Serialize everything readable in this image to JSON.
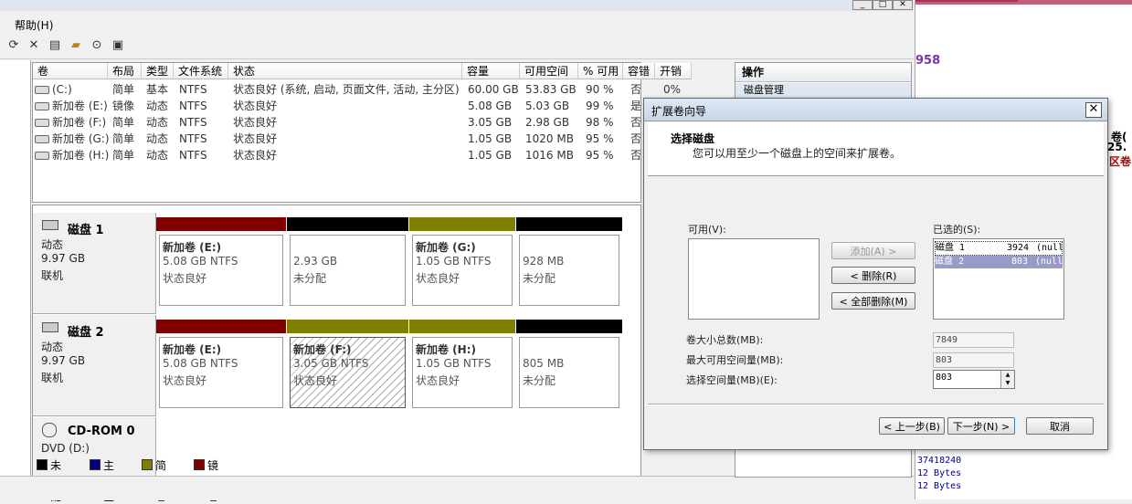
{
  "menu": {
    "help": "帮助(H)"
  },
  "window_buttons": {
    "minimize": "_",
    "maximize": "□",
    "close": "✕"
  },
  "toolbar_icons": [
    "refresh-icon",
    "delete-icon",
    "properties-icon",
    "open-folder-icon",
    "help-icon",
    "console-icon"
  ],
  "volume_table": {
    "headers": [
      "卷",
      "布局",
      "类型",
      "文件系统",
      "状态",
      "容量",
      "可用空间",
      "% 可用",
      "容错",
      "开销"
    ],
    "rows": [
      [
        "(C:)",
        "简单",
        "基本",
        "NTFS",
        "状态良好 (系统, 启动, 页面文件, 活动, 主分区)",
        "60.00 GB",
        "53.83 GB",
        "90 %",
        "否",
        "0%"
      ],
      [
        "新加卷 (E:)",
        "镜像",
        "动态",
        "NTFS",
        "状态良好",
        "5.08 GB",
        "5.03 GB",
        "99 %",
        "是",
        ""
      ],
      [
        "新加卷 (F:)",
        "简单",
        "动态",
        "NTFS",
        "状态良好",
        "3.05 GB",
        "2.98 GB",
        "98 %",
        "否",
        ""
      ],
      [
        "新加卷 (G:)",
        "简单",
        "动态",
        "NTFS",
        "状态良好",
        "1.05 GB",
        "1020 MB",
        "95 %",
        "否",
        ""
      ],
      [
        "新加卷 (H:)",
        "简单",
        "动态",
        "NTFS",
        "状态良好",
        "1.05 GB",
        "1016 MB",
        "95 %",
        "否",
        ""
      ]
    ]
  },
  "disks": [
    {
      "name": "磁盘 1",
      "type": "动态",
      "size": "9.97 GB",
      "status": "联机",
      "partitions": [
        {
          "name": "新加卷  (E:)",
          "size": "5.08 GB NTFS",
          "status": "状态良好",
          "color": "#800000"
        },
        {
          "name": "",
          "size": "2.93 GB",
          "status": "未分配",
          "color": "#000000"
        },
        {
          "name": "新加卷  (G:)",
          "size": "1.05 GB NTFS",
          "status": "状态良好",
          "color": "#808000"
        },
        {
          "name": "",
          "size": "928 MB",
          "status": "未分配",
          "color": "#000000"
        }
      ]
    },
    {
      "name": "磁盘 2",
      "type": "动态",
      "size": "9.97 GB",
      "status": "联机",
      "partitions": [
        {
          "name": "新加卷  (E:)",
          "size": "5.08 GB NTFS",
          "status": "状态良好",
          "color": "#800000"
        },
        {
          "name": "新加卷  (F:)",
          "size": "3.05 GB NTFS",
          "status": "状态良好",
          "color": "#808000"
        },
        {
          "name": "新加卷  (H:)",
          "size": "1.05 GB NTFS",
          "status": "状态良好",
          "color": "#808000"
        },
        {
          "name": "",
          "size": "805 MB",
          "status": "未分配",
          "color": "#000000"
        }
      ]
    },
    {
      "name": "CD-ROM 0",
      "type": "DVD (D:)"
    }
  ],
  "legend": [
    {
      "label": "未分配",
      "color": "#000000"
    },
    {
      "label": "主分区",
      "color": "#000080"
    },
    {
      "label": "简单卷",
      "color": "#808000"
    },
    {
      "label": "镜像卷",
      "color": "#800000"
    }
  ],
  "actions": {
    "title": "操作",
    "item": "磁盘管理"
  },
  "right_window": {
    "texts": [
      "958",
      "卷(",
      "25.",
      "区卷",
      "37418240",
      "12 Bytes",
      "12 Bytes"
    ]
  },
  "dialog": {
    "title": "扩展卷向导",
    "close": "✕",
    "heading": "选择磁盘",
    "subheading": "您可以用至少一个磁盘上的空间来扩展卷。",
    "available_label": "可用(V):",
    "selected_label": "已选的(S):",
    "add_button": "添加(A) >",
    "remove_button": "< 删除(R)",
    "remove_all_button": "< 全部删除(M)",
    "selected_items": [
      {
        "disk": "磁盘 1",
        "size": "3924",
        "extra": "(null"
      },
      {
        "disk": "磁盘 2",
        "size": "803",
        "extra": "(null"
      }
    ],
    "total_size_label": "卷大小总数(MB):",
    "total_size_value": "7849",
    "max_space_label": "最大可用空间量(MB):",
    "max_space_value": "803",
    "select_space_label": "选择空间量(MB)(E):",
    "select_space_value": "803",
    "back_button": "< 上一步(B)",
    "next_button": "下一步(N) >",
    "cancel_button": "取消"
  }
}
